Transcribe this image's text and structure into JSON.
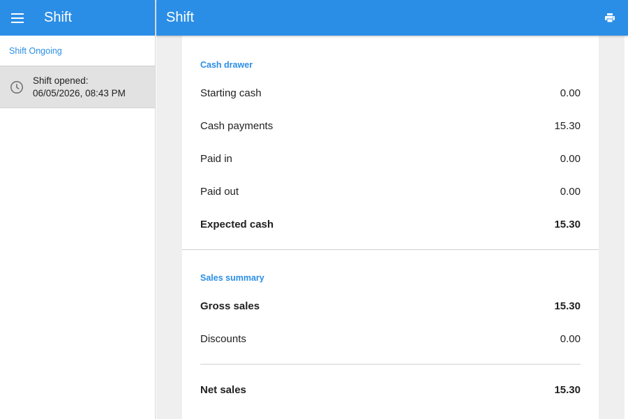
{
  "sidebar": {
    "title": "Shift",
    "section_label": "Shift Ongoing",
    "shift_item": {
      "line1": "Shift opened:",
      "line2": "06/05/2026, 08:43 PM"
    }
  },
  "header": {
    "title": "Shift",
    "print_icon": "print-icon"
  },
  "cash_drawer": {
    "heading": "Cash drawer",
    "rows": [
      {
        "label": "Starting cash",
        "value": "0.00"
      },
      {
        "label": "Cash payments",
        "value": "15.30"
      },
      {
        "label": "Paid in",
        "value": "0.00"
      },
      {
        "label": "Paid out",
        "value": "0.00"
      },
      {
        "label": "Expected cash",
        "value": "15.30"
      }
    ]
  },
  "sales_summary": {
    "heading": "Sales summary",
    "rows": [
      {
        "label": "Gross sales",
        "value": "15.30"
      },
      {
        "label": "Discounts",
        "value": "0.00"
      },
      {
        "label": "Net sales",
        "value": "15.30"
      }
    ]
  },
  "colors": {
    "accent": "#2b8ee6",
    "sidebar_selected": "#e2e2e2",
    "background": "#efefef"
  }
}
